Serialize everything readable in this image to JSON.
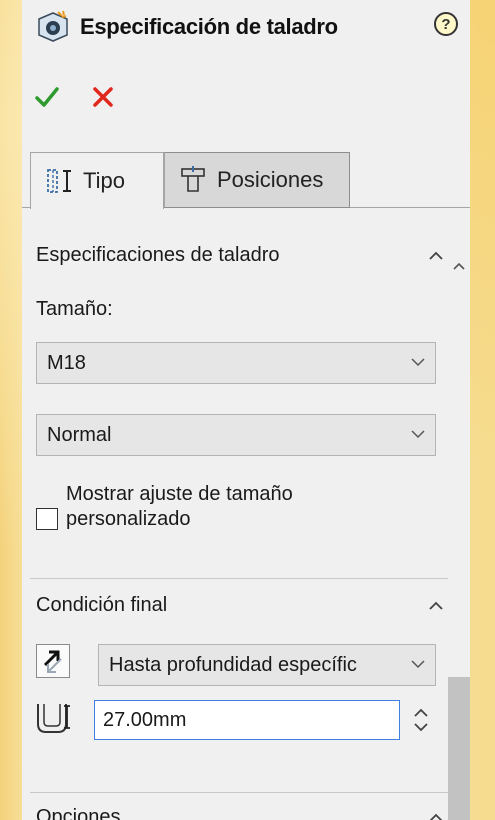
{
  "header": {
    "title": "Especificación de taladro",
    "help_symbol": "?",
    "icon": "hole-wizard-icon"
  },
  "actions": {
    "ok_icon": "checkmark-icon",
    "cancel_icon": "x-icon",
    "ok_color": "#2e9b2e",
    "cancel_color": "#e0281c"
  },
  "tabs": [
    {
      "label": "Tipo",
      "icon": "type-tab-icon",
      "active": true
    },
    {
      "label": "Posiciones",
      "icon": "positions-tab-icon",
      "active": false
    }
  ],
  "hole_spec": {
    "section_title": "Especificaciones de taladro",
    "size_label": "Tamaño:",
    "size_value": "M18",
    "fit_value": "Normal",
    "custom_size_label": "Mostrar ajuste de tamaño personalizado",
    "custom_size_checked": false
  },
  "end_condition": {
    "section_title": "Condición final",
    "type_value": "Hasta profundidad específic",
    "depth_value": "27.00mm"
  },
  "options": {
    "section_title": "Opciones"
  },
  "colors": {
    "panel_bg": "#f0f0f0",
    "desktop_bg": "#f7dd8d",
    "input_focus_border": "#3f7de0"
  }
}
